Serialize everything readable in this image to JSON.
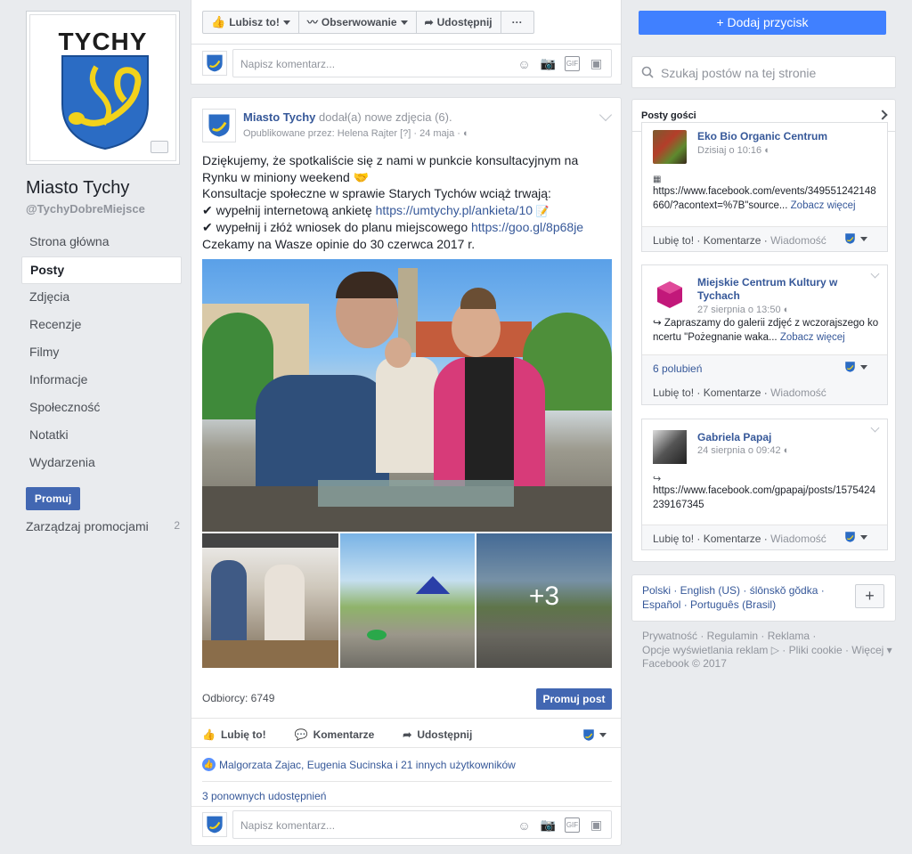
{
  "page": {
    "name": "Miasto Tychy",
    "handle": "@TychyDobreMiejsce",
    "logo_text": "TYCHY"
  },
  "leftnav": {
    "items": [
      "Strona główna",
      "Posty",
      "Zdjęcia",
      "Recenzje",
      "Filmy",
      "Informacje",
      "Społeczność",
      "Notatki",
      "Wydarzenia"
    ],
    "active": "Posty",
    "promote_label": "Promuj",
    "manage_promotions_label": "Zarządzaj promocjami",
    "manage_promotions_count": "2"
  },
  "topbar": {
    "like_label": "Lubisz to!",
    "follow_label": "Obserwowanie",
    "share_label": "Udostępnij",
    "more_label": "···",
    "add_button_label": "+ Dodaj przycisk"
  },
  "composer": {
    "placeholder": "Napisz komentarz..."
  },
  "post": {
    "author": "Miasto Tychy",
    "action": "dodał(a) nowe zdjęcia (6).",
    "published_by": "Opublikowane przez: Helena Rajter [?] · 24 maja ·",
    "text_lines": [
      "Dziękujemy, że spotkaliście się z nami w punkcie konsultacyjnym na Rynku w miniony weekend 🤝",
      "Konsultacje społeczne w sprawie Starych Tychów wciąż trwają:"
    ],
    "check1_text": "wypełnij internetową ankietę ",
    "check1_link": "https://umtychy.pl/ankieta/10",
    "check2_text": "wypełnij i złóż wniosek do planu miejscowego ",
    "check2_link": "https://goo.gl/8p68je",
    "closing": "Czekamy na Wasze opinie do 30 czerwca 2017 r.",
    "more_photos": "+3",
    "reach": "Odbiorcy: 6749",
    "promote_post_label": "Promuj post",
    "like_action": "Lubię to!",
    "comment_action": "Komentarze",
    "share_action": "Udostępnij",
    "likers": "Malgorzata Zajac, Eugenia Sucinska i 21 innych użytkowników",
    "shares": "3 ponownych udostępnień"
  },
  "search": {
    "placeholder": "Szukaj postów na tej stronie"
  },
  "visitor_posts": {
    "title": "Posty gości",
    "cards": [
      {
        "name": "Eko Bio Organic Centrum",
        "time": "Dzisiaj o 10:16",
        "body": "https://www.facebook.com/events/349551242148660/?acontext=%7B\"source...",
        "see_more": "Zobacz więcej",
        "likes": "",
        "footer_like": "Lubię to!",
        "footer_comment": "Komentarze",
        "footer_message": "Wiadomość"
      },
      {
        "name": "Miejskie Centrum Kultury w Tychach",
        "time": "27 sierpnia o 13:50",
        "body": "Zapraszamy do galerii zdjęć z wczorajszego koncertu \"Pożegnanie waka...",
        "see_more": "Zobacz więcej",
        "likes": "6 polubień",
        "footer_like": "Lubię to!",
        "footer_comment": "Komentarze",
        "footer_message": "Wiadomość"
      },
      {
        "name": "Gabriela Papaj",
        "time": "24 sierpnia o 09:42",
        "body": "https://www.facebook.com/gpapaj/posts/1575424239167345",
        "see_more": "",
        "likes": "",
        "footer_like": "Lubię to!",
        "footer_comment": "Komentarze",
        "footer_message": "Wiadomość"
      }
    ]
  },
  "languages": {
    "line1": "Polski · English (US) · ślōnskŏ gŏdka ·",
    "line2": "Español · Português (Brasil)",
    "plus": "+"
  },
  "footer": {
    "line1": "Prywatność · Regulamin · Reklama ·",
    "line2": "Opcje wyświetlania reklam ▷ · Pliki cookie · Więcej ▾",
    "line3": "Facebook © 2017"
  },
  "colors": {
    "brand_blue": "#4267b2",
    "accent_blue": "#4080ff",
    "link": "#365899",
    "shield_blue": "#2b6cc4",
    "shield_gold": "#f2d21b"
  }
}
